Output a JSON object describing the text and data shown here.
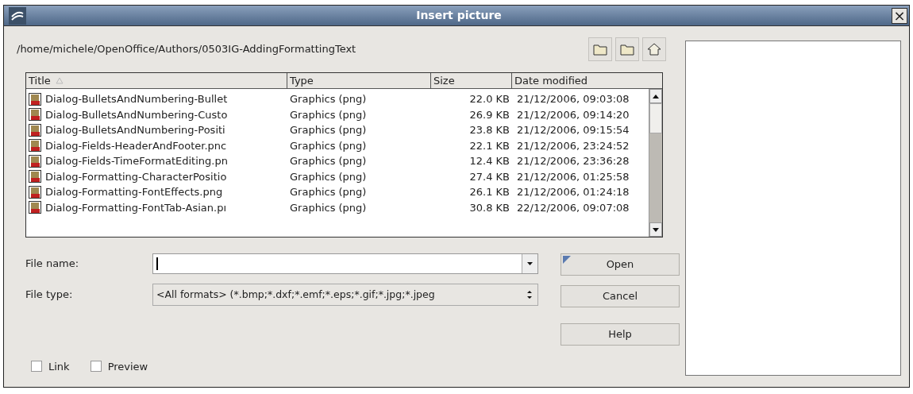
{
  "window": {
    "title": "Insert picture",
    "close": "×"
  },
  "path": "/home/michele/OpenOffice/Authors/0503IG-AddingFormattingText",
  "table": {
    "columns": [
      {
        "label": "Title",
        "sorted": true
      },
      {
        "label": "Type",
        "sorted": false
      },
      {
        "label": "Size",
        "sorted": false
      },
      {
        "label": "Date modified",
        "sorted": false
      }
    ],
    "rows": [
      {
        "title": "Dialog-BulletsAndNumbering-Bullet",
        "type": "Graphics (png)",
        "size": "22.0 KB",
        "date": "21/12/2006, 09:03:08"
      },
      {
        "title": "Dialog-BulletsAndNumbering-Custo",
        "type": "Graphics (png)",
        "size": "26.9 KB",
        "date": "21/12/2006, 09:14:20"
      },
      {
        "title": "Dialog-BulletsAndNumbering-Positi",
        "type": "Graphics (png)",
        "size": "23.8 KB",
        "date": "21/12/2006, 09:15:54"
      },
      {
        "title": "Dialog-Fields-HeaderAndFooter.pnc",
        "type": "Graphics (png)",
        "size": "22.1 KB",
        "date": "21/12/2006, 23:24:52"
      },
      {
        "title": "Dialog-Fields-TimeFormatEditing.pn",
        "type": "Graphics (png)",
        "size": "12.4 KB",
        "date": "21/12/2006, 23:36:28"
      },
      {
        "title": "Dialog-Formatting-CharacterPositio",
        "type": "Graphics (png)",
        "size": "27.4 KB",
        "date": "21/12/2006, 01:25:58"
      },
      {
        "title": "Dialog-Formatting-FontEffects.png",
        "type": "Graphics (png)",
        "size": "26.1 KB",
        "date": "21/12/2006, 01:24:18"
      },
      {
        "title": "Dialog-Formatting-FontTab-Asian.pı",
        "type": "Graphics (png)",
        "size": "30.8 KB",
        "date": "22/12/2006, 09:07:08"
      }
    ]
  },
  "file_name": {
    "label": "File name:"
  },
  "file_type": {
    "label": "File type:",
    "value": "<All formats> (*.bmp;*.dxf;*.emf;*.eps;*.gif;*.jpg;*.jpeg"
  },
  "buttons": [
    {
      "label": "Open",
      "default": true
    },
    {
      "label": "Cancel",
      "default": false
    },
    {
      "label": "Help",
      "default": false
    }
  ],
  "checkboxes": [
    {
      "label": "Link",
      "checked": false
    },
    {
      "label": "Preview",
      "checked": false
    }
  ]
}
